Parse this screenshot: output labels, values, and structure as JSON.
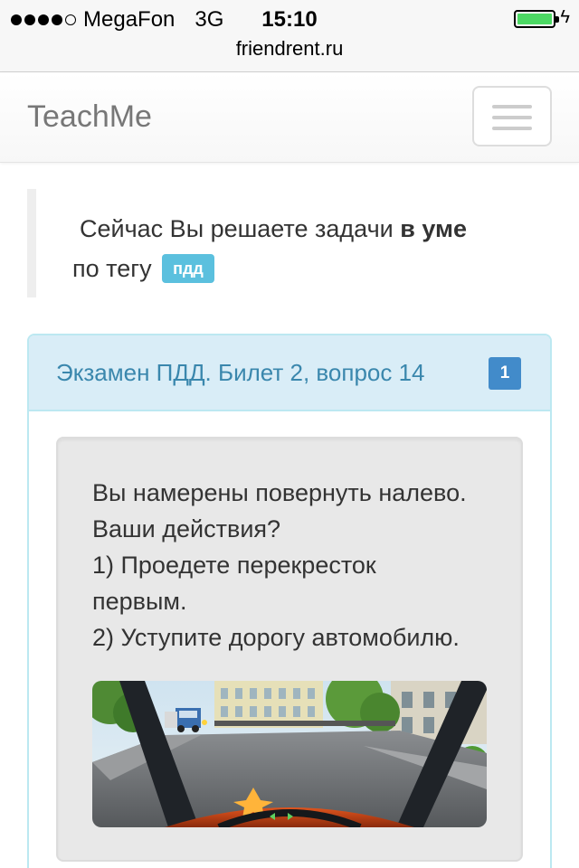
{
  "status_bar": {
    "carrier": "MegaFon",
    "network": "3G",
    "time": "15:10",
    "url": "friendrent.ru",
    "signal_bars": 4,
    "signal_max": 5,
    "battery_level": 1.0,
    "battery_color": "#4cd964"
  },
  "navbar": {
    "brand": "TeachMe",
    "menu_icon": "hamburger-icon"
  },
  "notice": {
    "text_before": "Сейчас Вы решаете задачи",
    "text_bold": "в уме",
    "text_tag_prefix": "по тегу",
    "tag": "пдд"
  },
  "panel": {
    "title": "Экзамен ПДД. Билет 2, вопрос 14",
    "badge": "1",
    "question_lines": [
      "Вы намерены повернуть налево.",
      "Ваши действия?",
      "1) Проедете перекресток",
      "первым.",
      "2) Уступите дорогу автомобилю."
    ]
  },
  "colors": {
    "panel_heading_bg": "#d9edf7",
    "panel_title": "#3a87ad",
    "badge_bg": "#428bca",
    "tag_bg": "#5bc0de"
  }
}
